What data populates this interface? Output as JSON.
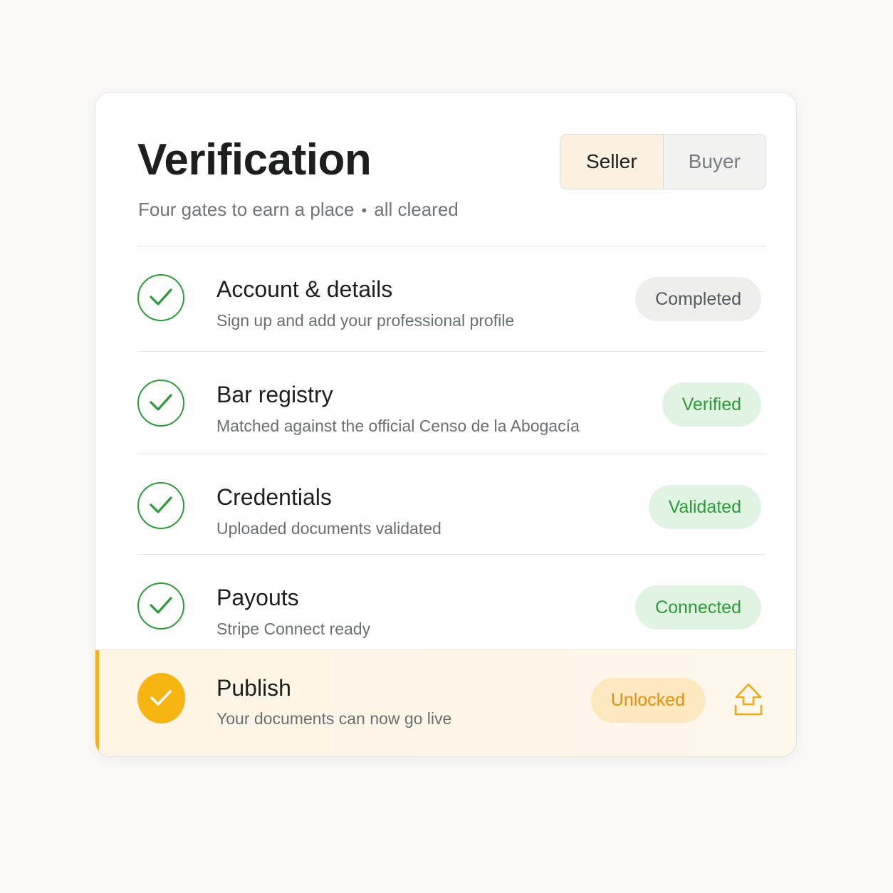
{
  "header": {
    "title": "Verification",
    "subtitle_main": "Four gates to earn a place",
    "subtitle_separator": "•",
    "subtitle_status": "all cleared"
  },
  "toggle": {
    "options": [
      {
        "label": "Seller",
        "active": true
      },
      {
        "label": "Buyer",
        "active": false
      }
    ]
  },
  "steps": [
    {
      "title": "Account & details",
      "description": "Sign up and add your professional profile",
      "status": "Completed",
      "status_style": "grey",
      "icon": "check-circle-icon"
    },
    {
      "title": "Bar registry",
      "description": "Matched against the official Censo de la Abogacía",
      "status": "Verified",
      "status_style": "green",
      "icon": "check-circle-icon"
    },
    {
      "title": "Credentials",
      "description": "Uploaded documents validated",
      "status": "Validated",
      "status_style": "green",
      "icon": "check-circle-icon"
    },
    {
      "title": "Payouts",
      "description": "Stripe Connect ready",
      "status": "Connected",
      "status_style": "green",
      "icon": "check-circle-icon"
    }
  ],
  "publish": {
    "title": "Publish",
    "description": "Your documents can now go live",
    "status": "Unlocked",
    "icon": "filled-check-circle-icon",
    "action_icon": "upload-icon"
  },
  "colors": {
    "background": "#faf9f6",
    "success": "#2e9b3a",
    "success_bg": "#e1f4e3",
    "accent": "#f7b512",
    "accent_bg": "#fde8bf",
    "accent_text": "#e68f0a"
  }
}
